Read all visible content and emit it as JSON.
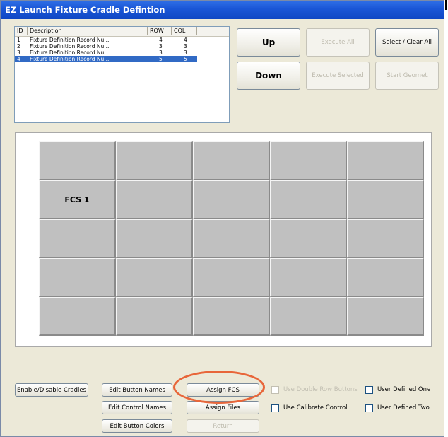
{
  "window": {
    "title": "EZ Launch Fixture Cradle Defintion"
  },
  "list": {
    "headers": [
      "ID",
      "Description",
      "ROW",
      "COL"
    ],
    "rows": [
      {
        "id": "1",
        "description": "Fixture Definition Record Nu...",
        "row": "4",
        "col": "4",
        "selected": false
      },
      {
        "id": "2",
        "description": "Fixture Definition Record Nu...",
        "row": "3",
        "col": "3",
        "selected": false
      },
      {
        "id": "3",
        "description": "Fixture Definition Record Nu...",
        "row": "3",
        "col": "3",
        "selected": false
      },
      {
        "id": "4",
        "description": "Fixture Definition Record Nu...",
        "row": "5",
        "col": "5",
        "selected": true
      }
    ]
  },
  "buttons": {
    "up": "Up",
    "down": "Down",
    "execute_all": "Execute All",
    "execute_selected": "Execute Selected",
    "select_clear_all": "Select / Clear All",
    "start_geomet": "Start Geomet",
    "enable_disable_cradles": "Enable/Disable Cradles",
    "edit_button_names": "Edit Button Names",
    "edit_control_names": "Edit Control  Names",
    "edit_button_colors": "Edit Button Colors",
    "assign_fcs": "Assign FCS",
    "assign_files": "Assign Files",
    "return": "Return"
  },
  "grid": {
    "rows": 5,
    "cols": 5,
    "labels": [
      [
        "",
        "",
        "",
        "",
        ""
      ],
      [
        "FCS 1",
        "",
        "",
        "",
        ""
      ],
      [
        "",
        "",
        "",
        "",
        ""
      ],
      [
        "",
        "",
        "",
        "",
        ""
      ],
      [
        "",
        "",
        "",
        "",
        ""
      ]
    ]
  },
  "checkboxes": {
    "use_double_row_buttons": {
      "label": "Use Double Row Buttons",
      "checked": false,
      "enabled": false
    },
    "use_calibrate_control": {
      "label": "Use Calibrate Control",
      "checked": false,
      "enabled": true
    },
    "user_defined_one": {
      "label": "User Defined One",
      "checked": false,
      "enabled": true
    },
    "user_defined_two": {
      "label": "User Defined Two",
      "checked": false,
      "enabled": true
    }
  },
  "colors": {
    "titlebar": "#1a56d6",
    "window_bg": "#ECE9D8",
    "selection": "#316ac5",
    "cradle": "#c0c0c0",
    "highlight": "#e8663a"
  }
}
